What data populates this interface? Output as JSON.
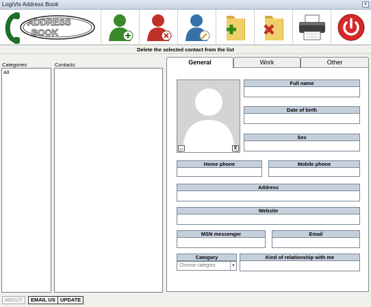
{
  "window": {
    "title": "LogiVis Address Book",
    "close_glyph": "×"
  },
  "logo": {
    "word1": "ADDRESS",
    "word2": "BOOK"
  },
  "toolbar": {
    "buttons": [
      {
        "name": "add-contact-button",
        "icon": "person-add-icon"
      },
      {
        "name": "delete-contact-button",
        "icon": "person-delete-icon"
      },
      {
        "name": "edit-contact-button",
        "icon": "person-edit-icon"
      },
      {
        "name": "add-category-button",
        "icon": "folder-add-icon"
      },
      {
        "name": "delete-category-button",
        "icon": "folder-delete-icon"
      },
      {
        "name": "print-button",
        "icon": "printer-icon"
      },
      {
        "name": "exit-button",
        "icon": "power-icon"
      }
    ],
    "colors": {
      "green": "#3a8a2a",
      "red": "#c0312a",
      "blue": "#3672a8",
      "folder": "#e8c45a",
      "power": "#d82828"
    }
  },
  "status": {
    "text": "Delete the selected contact from the list"
  },
  "left": {
    "categories_label": "Categories",
    "categories": [
      "All"
    ],
    "contacts_label": "Contacts",
    "contacts": []
  },
  "buttons": {
    "about": "ABOUT",
    "email": "EMAIL US",
    "update": "UPDATE"
  },
  "tabs": [
    "General",
    "Work",
    "Other"
  ],
  "form": {
    "full_name": "Full name",
    "dob": "Date of birth",
    "sex": "Sex",
    "home_phone": "Home phone",
    "mobile_phone": "Mobile phone",
    "address": "Address",
    "website": "Website",
    "msn": "MSN messenger",
    "email": "Email",
    "category": "Category",
    "category_placeholder": "Choose category",
    "relationship": "Kind of relationship with me",
    "photo_browse": "...",
    "photo_clear": "X"
  }
}
